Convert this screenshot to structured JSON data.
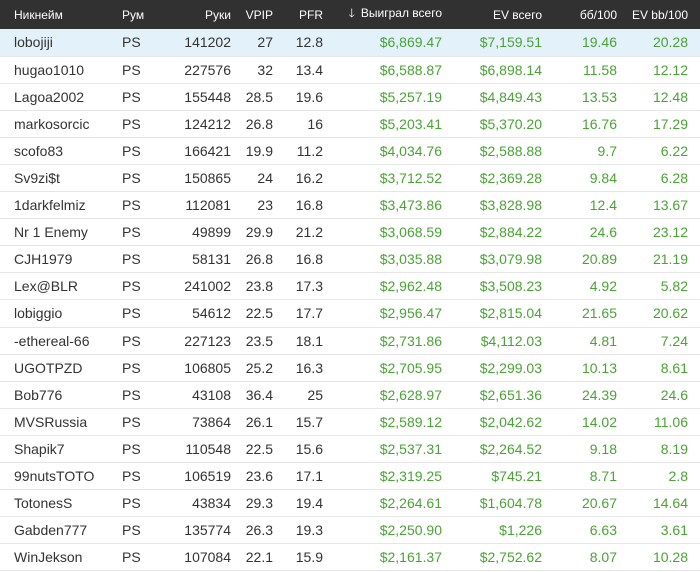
{
  "table": {
    "headers": {
      "nickname": "Никнейм",
      "room": "Рум",
      "hands": "Руки",
      "vpip": "VPIP",
      "pfr": "PFR",
      "won_total": "Выиграл всего",
      "ev_total": "EV всего",
      "bb100": "бб/100",
      "ev_bb100": "EV bb/100"
    },
    "sort": {
      "column": "won_total",
      "direction": "descending",
      "icon": "arrow-down-icon",
      "symbol": "🡓"
    },
    "rows": [
      {
        "nick": "lobojiji",
        "room": "PS",
        "hands": "141202",
        "vpip": "27",
        "pfr": "12.8",
        "won": "$6,869.47",
        "ev": "$7,159.51",
        "bb100": "19.46",
        "evbb": "20.28"
      },
      {
        "nick": "hugao1010",
        "room": "PS",
        "hands": "227576",
        "vpip": "32",
        "pfr": "13.4",
        "won": "$6,588.87",
        "ev": "$6,898.14",
        "bb100": "11.58",
        "evbb": "12.12"
      },
      {
        "nick": "Lagoa2002",
        "room": "PS",
        "hands": "155448",
        "vpip": "28.5",
        "pfr": "19.6",
        "won": "$5,257.19",
        "ev": "$4,849.43",
        "bb100": "13.53",
        "evbb": "12.48"
      },
      {
        "nick": "markosorcic",
        "room": "PS",
        "hands": "124212",
        "vpip": "26.8",
        "pfr": "16",
        "won": "$5,203.41",
        "ev": "$5,370.20",
        "bb100": "16.76",
        "evbb": "17.29"
      },
      {
        "nick": "scofo83",
        "room": "PS",
        "hands": "166421",
        "vpip": "19.9",
        "pfr": "11.2",
        "won": "$4,034.76",
        "ev": "$2,588.88",
        "bb100": "9.7",
        "evbb": "6.22"
      },
      {
        "nick": "Sv9zi$t",
        "room": "PS",
        "hands": "150865",
        "vpip": "24",
        "pfr": "16.2",
        "won": "$3,712.52",
        "ev": "$2,369.28",
        "bb100": "9.84",
        "evbb": "6.28"
      },
      {
        "nick": "1darkfelmiz",
        "room": "PS",
        "hands": "112081",
        "vpip": "23",
        "pfr": "16.8",
        "won": "$3,473.86",
        "ev": "$3,828.98",
        "bb100": "12.4",
        "evbb": "13.67"
      },
      {
        "nick": "Nr 1 Enemy",
        "room": "PS",
        "hands": "49899",
        "vpip": "29.9",
        "pfr": "21.2",
        "won": "$3,068.59",
        "ev": "$2,884.22",
        "bb100": "24.6",
        "evbb": "23.12"
      },
      {
        "nick": "CJH1979",
        "room": "PS",
        "hands": "58131",
        "vpip": "26.8",
        "pfr": "16.8",
        "won": "$3,035.88",
        "ev": "$3,079.98",
        "bb100": "20.89",
        "evbb": "21.19"
      },
      {
        "nick": "Lex@BLR",
        "room": "PS",
        "hands": "241002",
        "vpip": "23.8",
        "pfr": "17.3",
        "won": "$2,962.48",
        "ev": "$3,508.23",
        "bb100": "4.92",
        "evbb": "5.82"
      },
      {
        "nick": "lobiggio",
        "room": "PS",
        "hands": "54612",
        "vpip": "22.5",
        "pfr": "17.7",
        "won": "$2,956.47",
        "ev": "$2,815.04",
        "bb100": "21.65",
        "evbb": "20.62"
      },
      {
        "nick": "-ethereal-66",
        "room": "PS",
        "hands": "227123",
        "vpip": "23.5",
        "pfr": "18.1",
        "won": "$2,731.86",
        "ev": "$4,112.03",
        "bb100": "4.81",
        "evbb": "7.24"
      },
      {
        "nick": "UGOTPZD",
        "room": "PS",
        "hands": "106805",
        "vpip": "25.2",
        "pfr": "16.3",
        "won": "$2,705.95",
        "ev": "$2,299.03",
        "bb100": "10.13",
        "evbb": "8.61"
      },
      {
        "nick": "Bob776",
        "room": "PS",
        "hands": "43108",
        "vpip": "36.4",
        "pfr": "25",
        "won": "$2,628.97",
        "ev": "$2,651.36",
        "bb100": "24.39",
        "evbb": "24.6"
      },
      {
        "nick": "MVSRussia",
        "room": "PS",
        "hands": "73864",
        "vpip": "26.1",
        "pfr": "15.7",
        "won": "$2,589.12",
        "ev": "$2,042.62",
        "bb100": "14.02",
        "evbb": "11.06"
      },
      {
        "nick": "Shapik7",
        "room": "PS",
        "hands": "110548",
        "vpip": "22.5",
        "pfr": "15.6",
        "won": "$2,537.31",
        "ev": "$2,264.52",
        "bb100": "9.18",
        "evbb": "8.19"
      },
      {
        "nick": "99nutsTOTO",
        "room": "PS",
        "hands": "106519",
        "vpip": "23.6",
        "pfr": "17.1",
        "won": "$2,319.25",
        "ev": "$745.21",
        "bb100": "8.71",
        "evbb": "2.8"
      },
      {
        "nick": "TotonesS",
        "room": "PS",
        "hands": "43834",
        "vpip": "29.3",
        "pfr": "19.4",
        "won": "$2,264.61",
        "ev": "$1,604.78",
        "bb100": "20.67",
        "evbb": "14.64"
      },
      {
        "nick": "Gabden777",
        "room": "PS",
        "hands": "135774",
        "vpip": "26.3",
        "pfr": "19.3",
        "won": "$2,250.90",
        "ev": "$1,226",
        "bb100": "6.63",
        "evbb": "3.61"
      },
      {
        "nick": "WinJekson",
        "room": "PS",
        "hands": "107084",
        "vpip": "22.1",
        "pfr": "15.9",
        "won": "$2,161.37",
        "ev": "$2,752.62",
        "bb100": "8.07",
        "evbb": "10.28"
      }
    ]
  },
  "colors": {
    "header_bg": "#313131",
    "header_text": "#ffffff",
    "positive_green": "#4aa335",
    "highlight_row": "#e3f1fb",
    "row_border": "#e6e6e6"
  }
}
